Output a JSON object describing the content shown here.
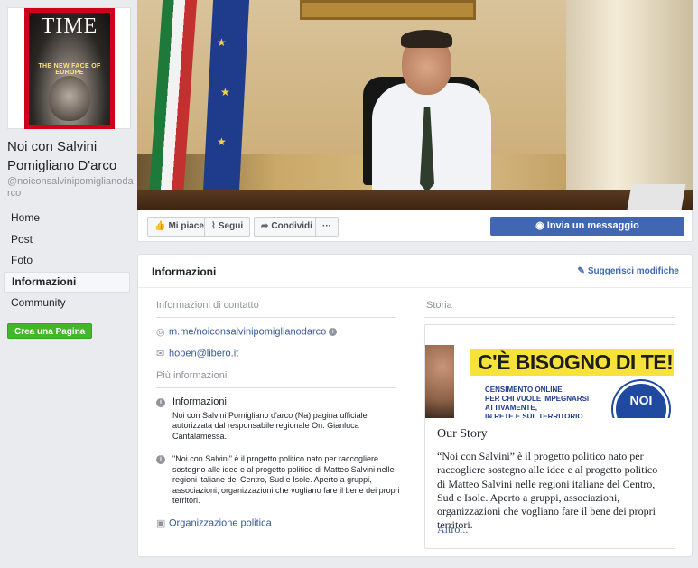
{
  "profile": {
    "cover_logo": "TIME",
    "cover_subtitle": "THE NEW FACE OF EUROPE",
    "page_name": "Noi con Salvini Pomigliano D'arco",
    "handle": "@noiconsalvinipomiglianodarco"
  },
  "nav": {
    "items": [
      {
        "label": "Home"
      },
      {
        "label": "Post"
      },
      {
        "label": "Foto"
      },
      {
        "label": "Informazioni"
      },
      {
        "label": "Community"
      }
    ],
    "create_page": "Crea una Pagina"
  },
  "actions": {
    "like": "Mi piace",
    "follow": "Segui",
    "share": "Condividi",
    "more": "···",
    "message": "Invia un messaggio"
  },
  "info": {
    "title": "Informazioni",
    "suggest": "Suggerisci modifiche",
    "contact_heading": "Informazioni di contatto",
    "messenger_link": "m.me/noiconsalvinipomiglianodarco",
    "email": "hopen@libero.it",
    "more_heading": "Più informazioni",
    "about_label": "Informazioni",
    "about_text": "Noi con Salvini Pomigliano d'arco (Na) pagina ufficiale autorizzata dal responsabile regionale On. Gianluca Cantalamessa.",
    "description": "\"Noi con Salvini\" è il progetto politico nato per raccogliere sostegno alle idee e al progetto politico di Matteo Salvini nelle regioni italiane del Centro, Sud e Isole. Aperto a gruppi, associazioni, organizzazioni che vogliano fare il bene dei propri territori.",
    "category": "Organizzazione politica"
  },
  "story": {
    "heading": "Storia",
    "image_headline": "C'È BISOGNO DI TE!",
    "image_small": "CENSIMENTO ONLINE\nPER CHI VUOLE IMPEGNARSI\nATTIVAMENTE,\nIN RETE E SUL TERRITORIO",
    "image_badge": "NOI",
    "title": "Our Story",
    "text": "“Noi con Salvini” è il progetto politico nato per raccogliere sostegno alle idee e al progetto politico di Matteo Salvini nelle regioni italiane del Centro, Sud e Isole. Aperto a gruppi, associazioni, organizzazioni che vogliano fare il bene dei propri territori.",
    "more": "Altro..."
  },
  "colors": {
    "brand_blue": "#4267b2",
    "create_green": "#42b72a",
    "link": "#385898",
    "background": "#e9ebee"
  },
  "icons": [
    "like-icon",
    "rss-icon",
    "share-icon",
    "messenger-icon",
    "email-icon",
    "info-icon",
    "category-icon",
    "pencil-icon"
  ]
}
